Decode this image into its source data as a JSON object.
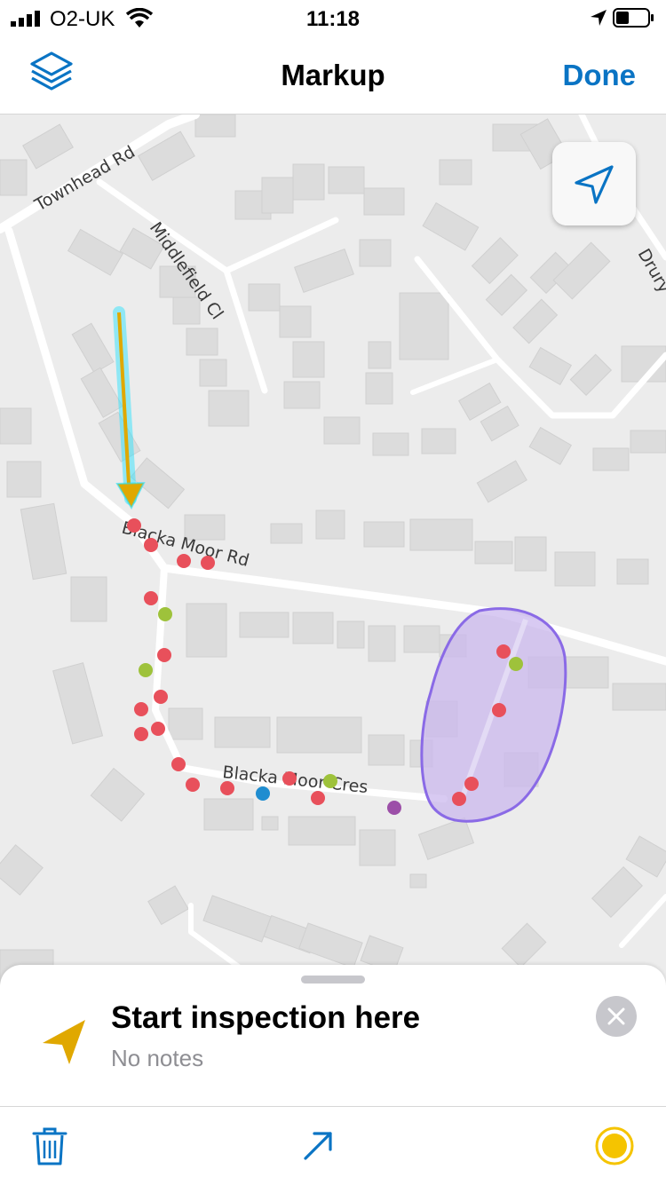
{
  "status_bar": {
    "carrier": "O2-UK",
    "time": "11:18"
  },
  "nav": {
    "title": "Markup",
    "done_label": "Done",
    "layers_icon": "layers-icon"
  },
  "map": {
    "road_labels": [
      {
        "text": "Townhead Rd"
      },
      {
        "text": "Middlefield Cl"
      },
      {
        "text": "Blacka Moor Rd"
      },
      {
        "text": "Blacka Moor Cres"
      },
      {
        "text": "Drury"
      }
    ],
    "locate_icon": "navigation-arrow-icon",
    "colors": {
      "arrow": "#e0a800",
      "arrow_glow": "#1fe3ff",
      "polygon_fill": "#cbb8ee",
      "polygon_stroke": "#8a6ae6",
      "point_red": "#e8505b",
      "point_green": "#9ec23b",
      "point_blue": "#1f8dd0",
      "point_purple": "#9c4fa8"
    }
  },
  "sheet": {
    "title": "Start inspection here",
    "subtitle": "No notes",
    "marker_icon": "yellow-arrow-marker-icon",
    "close_icon": "close-icon"
  },
  "toolbar": {
    "items": [
      {
        "icon": "trash-icon",
        "color": "#0a74c4"
      },
      {
        "icon": "arrow-tool-icon",
        "color": "#0a74c4"
      },
      {
        "icon": "color-picker-icon",
        "color": "#f5c400"
      }
    ]
  }
}
